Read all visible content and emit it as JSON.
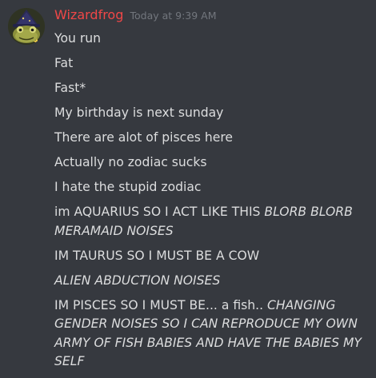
{
  "message_group": {
    "username": "Wizardfrog",
    "username_color": "#f04747",
    "timestamp": "Today at 9:39 AM",
    "avatar_icon": "frog-wizard-avatar-icon",
    "messages": [
      {
        "text": "You run"
      },
      {
        "text": "Fat"
      },
      {
        "text": "Fast*"
      },
      {
        "text": "My birthday is next sunday"
      },
      {
        "text": "There are alot of pisces here"
      },
      {
        "text": "Actually no zodiac sucks"
      },
      {
        "text": "I hate the stupid zodiac"
      },
      {
        "text": "im AQUARIUS SO I ACT LIKE THIS ",
        "italic": "BLORB BLORB MERAMAID NOISES"
      },
      {
        "text": "IM TAURUS SO I MUST BE A COW"
      },
      {
        "italic": "ALIEN ABDUCTION NOISES"
      },
      {
        "text": "IM PISCES SO I MUST BE... a fish.. ",
        "italic": "CHANGING GENDER NOISES SO I CAN REPRODUCE MY OWN ARMY OF FISH BABIES AND HAVE THE BABIES MY SELF"
      }
    ]
  }
}
